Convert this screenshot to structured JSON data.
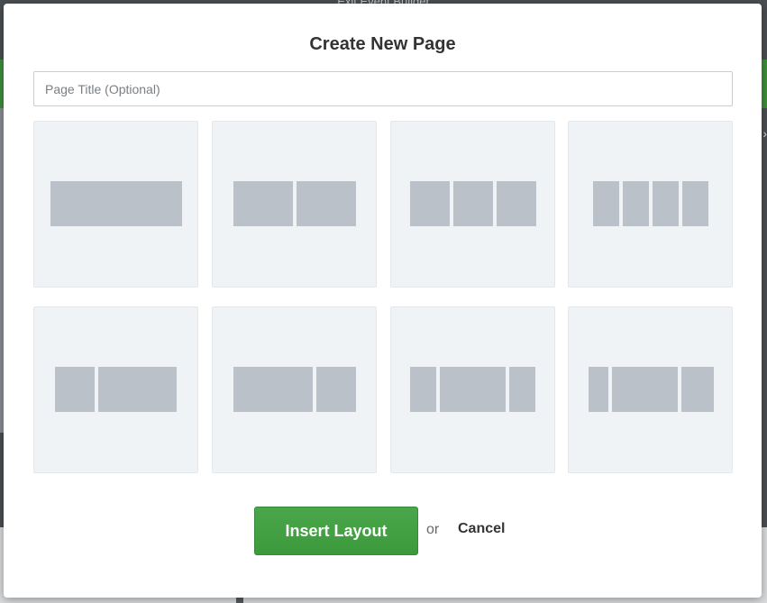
{
  "background": {
    "top_label": "Exit Event Builder"
  },
  "modal": {
    "title": "Create New Page",
    "page_title_input": {
      "value": "",
      "placeholder": "Page Title (Optional)"
    },
    "layouts": [
      {
        "id": "one-column",
        "columns": 1,
        "ratios": [
          1
        ]
      },
      {
        "id": "two-columns-equal",
        "columns": 2,
        "ratios": [
          1,
          1
        ]
      },
      {
        "id": "three-columns-equal",
        "columns": 3,
        "ratios": [
          1,
          1,
          1
        ]
      },
      {
        "id": "four-columns-equal",
        "columns": 4,
        "ratios": [
          1,
          1,
          1,
          1
        ]
      },
      {
        "id": "two-columns-narrow-wide",
        "columns": 2,
        "ratios": [
          1,
          2
        ]
      },
      {
        "id": "two-columns-wide-narrow",
        "columns": 2,
        "ratios": [
          2,
          1
        ]
      },
      {
        "id": "three-columns-narrow-wide-narrow",
        "columns": 3,
        "ratios": [
          1,
          2.5,
          1
        ]
      },
      {
        "id": "three-columns-narrow-wider-narrow",
        "columns": 3,
        "ratios": [
          0.6,
          2,
          1
        ]
      }
    ],
    "insert_label": "Insert Layout",
    "or_label": "or",
    "cancel_label": "Cancel"
  },
  "colors": {
    "accent_green": "#43a043",
    "tile_bg": "#f0f3f6",
    "block": "#bac1c8"
  }
}
